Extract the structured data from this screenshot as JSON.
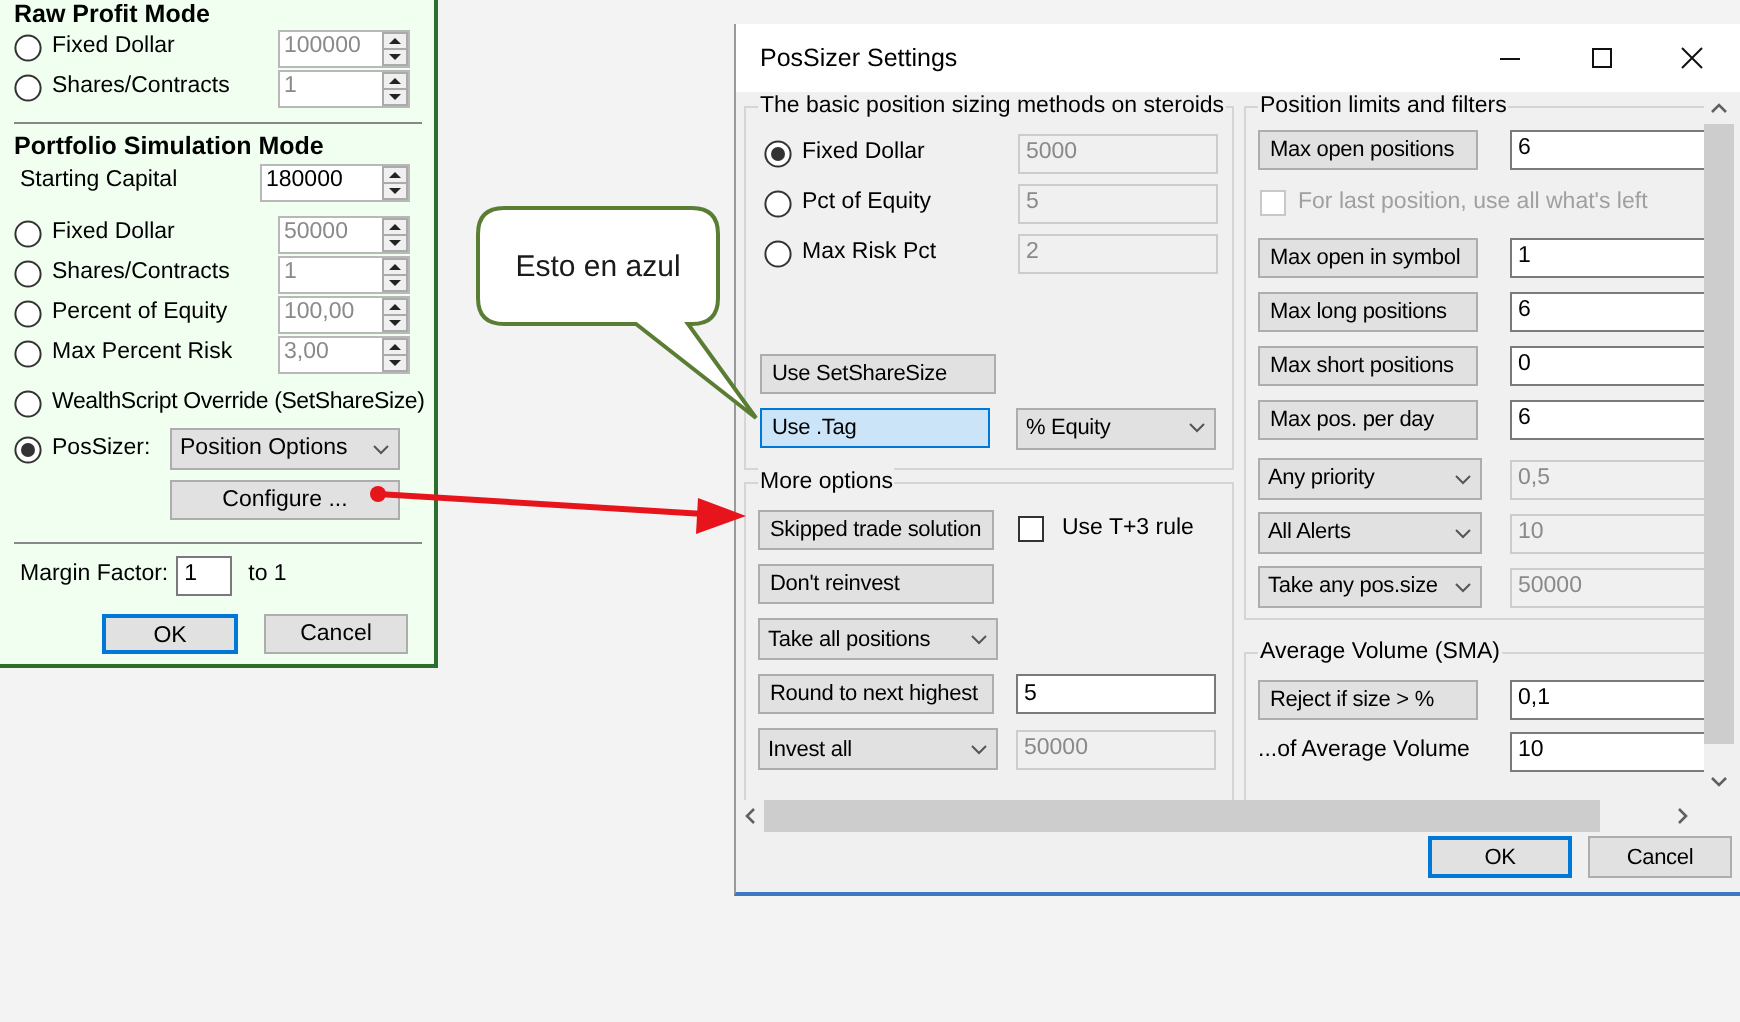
{
  "settings_panel": {
    "raw_profit": {
      "title": "Raw Profit Mode",
      "options": [
        {
          "label": "Fixed Dollar",
          "value": "100000",
          "selected": false,
          "disabled": true
        },
        {
          "label": "Shares/Contracts",
          "value": "1",
          "selected": false,
          "disabled": true
        }
      ]
    },
    "portfolio": {
      "title": "Portfolio Simulation Mode",
      "starting_capital": {
        "label": "Starting Capital",
        "value": "180000",
        "disabled": false
      },
      "options": [
        {
          "kind": "spin",
          "label": "Fixed Dollar",
          "value": "50000",
          "selected": false,
          "disabled": true
        },
        {
          "kind": "spin",
          "label": "Shares/Contracts",
          "value": "1",
          "selected": false,
          "disabled": true
        },
        {
          "kind": "spin",
          "label": "Percent of Equity",
          "value": "100,00",
          "selected": false,
          "disabled": true
        },
        {
          "kind": "spin",
          "label": "Max Percent Risk",
          "value": "3,00",
          "selected": false,
          "disabled": true
        },
        {
          "kind": "plain",
          "label": "WealthScript Override (SetShareSize)",
          "selected": false
        },
        {
          "kind": "combo",
          "label": "PosSizer:",
          "value": "Position Options",
          "selected": true
        }
      ],
      "configure_button": "Configure ...",
      "margin": {
        "label": "Margin Factor:",
        "value": "1",
        "suffix": "to 1"
      },
      "buttons": [
        {
          "label": "OK",
          "default": true
        },
        {
          "label": "Cancel",
          "default": false
        }
      ]
    }
  },
  "dialog": {
    "title": "PosSizer Settings",
    "basic_group": {
      "title": "The basic position sizing methods on steroids",
      "options": [
        {
          "label": "Fixed Dollar",
          "value": "5000",
          "selected": true,
          "disabled": true
        },
        {
          "label": "Pct of Equity",
          "value": "5",
          "selected": false,
          "disabled": true
        },
        {
          "label": "Max Risk Pct",
          "value": "2",
          "selected": false,
          "disabled": true
        }
      ],
      "share_size_button": "Use SetShareSize",
      "tag_button": {
        "label": "Use .Tag",
        "highlighted": true
      },
      "tag_select": "% Equity"
    },
    "more_options": {
      "title": "More options",
      "rows": [
        {
          "kind": "button_check",
          "button": "Skipped trade solution",
          "check_label": "Use T+3 rule",
          "checked": false
        },
        {
          "kind": "button",
          "button": "Don't reinvest"
        },
        {
          "kind": "select",
          "select": "Take all positions"
        },
        {
          "kind": "button_input",
          "button": "Round to next highest",
          "value": "5",
          "disabled": false
        },
        {
          "kind": "select_input",
          "select": "Invest all",
          "value": "50000",
          "disabled": true
        }
      ]
    },
    "limits": {
      "title": "Position limits and filters",
      "rows": [
        {
          "kind": "button_input",
          "button": "Max open positions",
          "value": "6",
          "disabled": false
        },
        {
          "kind": "check",
          "check_label": "For last position, use all what's left",
          "checked": false,
          "disabled": true
        },
        {
          "kind": "button_input",
          "button": "Max open in symbol",
          "value": "1",
          "disabled": false
        },
        {
          "kind": "button_input",
          "button": "Max long positions",
          "value": "6",
          "disabled": false
        },
        {
          "kind": "button_input",
          "button": "Max short positions",
          "value": "0",
          "disabled": false
        },
        {
          "kind": "button_input",
          "button": "Max pos. per day",
          "value": "6",
          "disabled": false
        },
        {
          "kind": "select_input",
          "select": "Any priority",
          "value": "0,5",
          "disabled": true
        },
        {
          "kind": "select_input",
          "select": "All Alerts",
          "value": "10",
          "disabled": true
        },
        {
          "kind": "select_input",
          "select": "Take any pos.size",
          "value": "50000",
          "disabled": true
        }
      ]
    },
    "average_volume": {
      "title": "Average Volume (SMA)",
      "rows": [
        {
          "kind": "button_input",
          "button": "Reject if size > %",
          "value": "0,1",
          "disabled": false
        },
        {
          "kind": "label_input",
          "label": "...of Average Volume",
          "value": "10",
          "disabled": false
        }
      ]
    },
    "buttons": [
      {
        "label": "OK",
        "default": true
      },
      {
        "label": "Cancel",
        "default": false
      }
    ]
  },
  "callout": {
    "text": "Esto en azul"
  }
}
